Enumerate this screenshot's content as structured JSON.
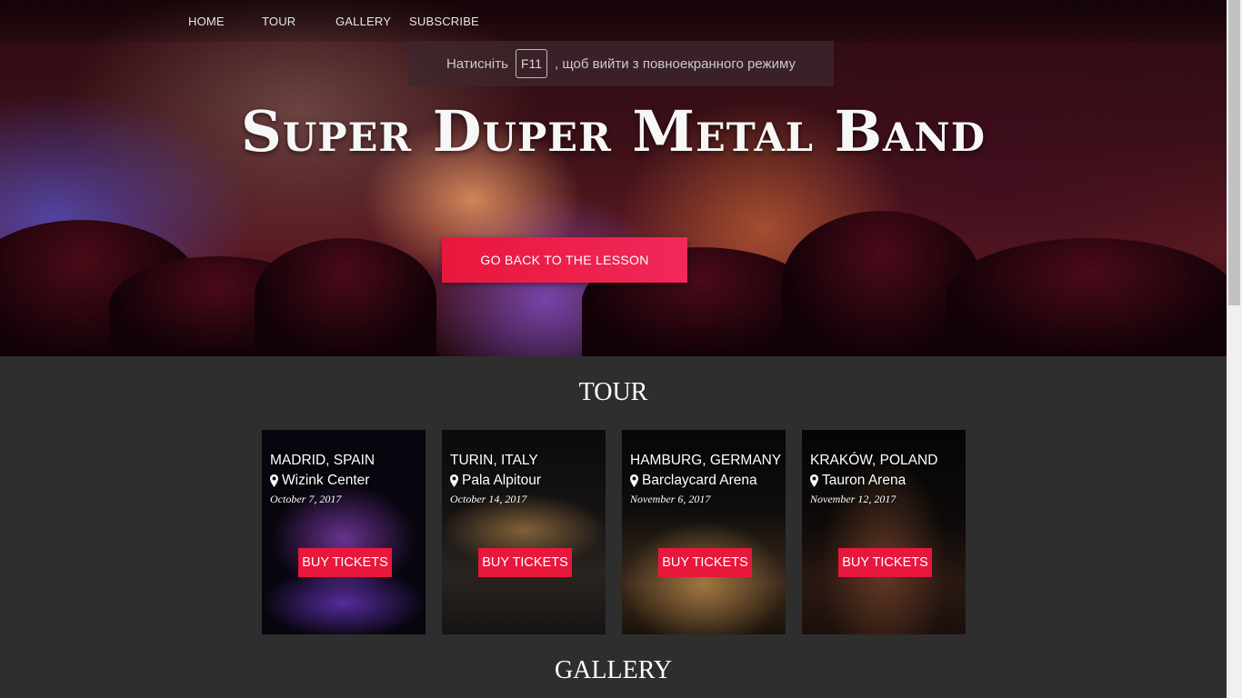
{
  "nav": {
    "items": [
      {
        "label": "HOME"
      },
      {
        "label": "TOUR"
      },
      {
        "label": "GALLERY"
      },
      {
        "label": "SUBSCRIBE"
      }
    ]
  },
  "fullscreen_notice": {
    "before_key": "Натисніть",
    "key": "F11",
    "after_key": ", щоб вийти з повноекранного режиму"
  },
  "hero": {
    "title": "Super Duper Metal Band",
    "cta_label": "GO BACK TO THE LESSON"
  },
  "tour": {
    "heading": "TOUR",
    "cards": [
      {
        "city": "MADRID, SPAIN",
        "venue": "Wizink Center",
        "date": "October 7, 2017",
        "button": "BUY TICKETS"
      },
      {
        "city": "TURIN, ITALY",
        "venue": "Pala Alpitour",
        "date": "October 14, 2017",
        "button": "BUY TICKETS"
      },
      {
        "city": "HAMBURG, GERMANY",
        "venue": "Barclaycard Arena",
        "date": "November 6, 2017",
        "button": "BUY TICKETS"
      },
      {
        "city": "KRAKÓW, POLAND",
        "venue": "Tauron Arena",
        "date": "November 12, 2017",
        "button": "BUY TICKETS"
      }
    ]
  },
  "gallery": {
    "heading": "GALLERY"
  },
  "colors": {
    "accent": "#e8173c",
    "section_bg": "#2e2e2e"
  }
}
